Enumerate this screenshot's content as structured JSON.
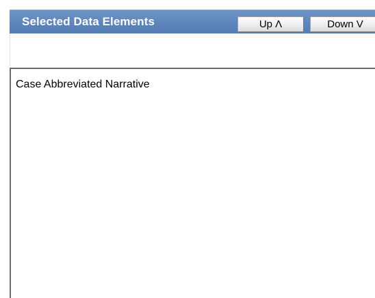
{
  "header": {
    "title": "Selected Data Elements",
    "up_label": "Up Λ",
    "down_label": "Down V"
  },
  "list": {
    "items": [
      {
        "label": "Case Abbreviated Narrative"
      }
    ]
  },
  "colors": {
    "header_background": "#5d85bb",
    "header_text": "#ffffff",
    "list_border": "#6a6a6a"
  }
}
